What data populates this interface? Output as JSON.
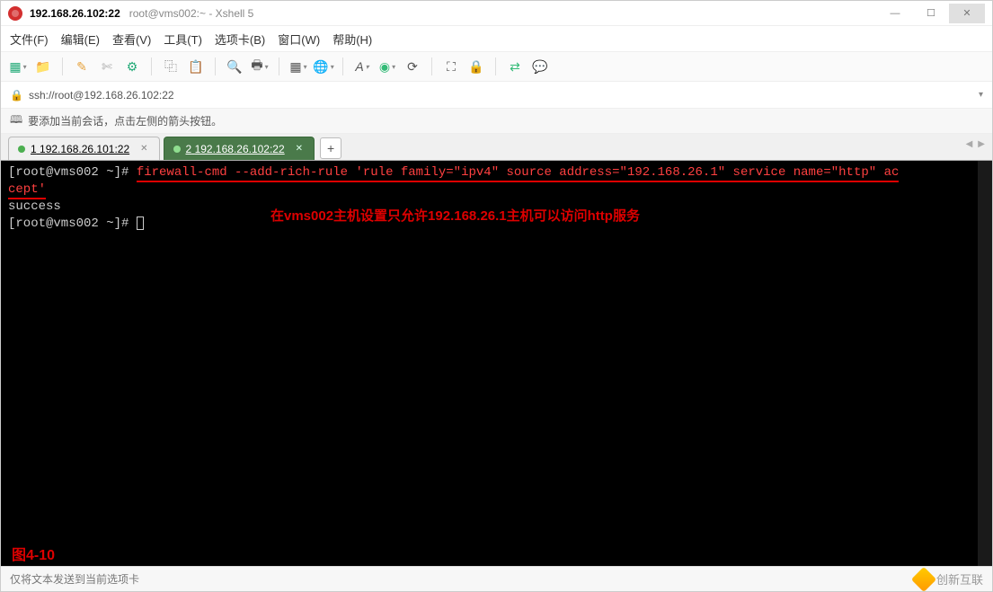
{
  "title": {
    "host_port": "192.168.26.102:22",
    "subtitle": "root@vms002:~ - Xshell 5"
  },
  "menu": {
    "file": "文件(F)",
    "edit": "编辑(E)",
    "view": "查看(V)",
    "tools": "工具(T)",
    "tabs": "选项卡(B)",
    "window": "窗口(W)",
    "help": "帮助(H)"
  },
  "address": {
    "url": "ssh://root@192.168.26.102:22"
  },
  "infobar": {
    "text": "要添加当前会话，点击左侧的箭头按钮。"
  },
  "tabs": {
    "items": [
      {
        "num": "1",
        "label": "192.168.26.101:22",
        "active": false
      },
      {
        "num": "2",
        "label": "192.168.26.102:22",
        "active": true
      }
    ]
  },
  "terminal": {
    "prompt": "[root@vms002 ~]# ",
    "cmd_part1": "firewall-cmd --add-rich-rule 'rule family=\"ipv4\" source address=\"192.168.26.1\" service name=\"http\" ac",
    "cmd_part2": "cept'",
    "result": "success",
    "prompt2": "[root@vms002 ~]# ",
    "annotation": "在vms002主机设置只允许192.168.26.1主机可以访问http服务",
    "figure_label": "图4-10"
  },
  "statusbar": {
    "text": "仅将文本发送到当前选项卡",
    "watermark": "创新互联"
  },
  "icons": {
    "new": "new-session-icon",
    "open": "open-icon",
    "pencil": "pencil-icon",
    "scissors": "scissors-icon",
    "props": "properties-icon",
    "copy": "copy-icon",
    "paste": "paste-icon",
    "find": "find-icon",
    "print": "print-icon",
    "layout": "layout-icon",
    "globe": "globe-icon",
    "font": "font-icon",
    "color": "color-icon",
    "refresh": "refresh-icon",
    "fullscreen": "fullscreen-icon",
    "lock": "lock-icon",
    "transfer": "transfer-icon",
    "chat": "chat-icon"
  }
}
